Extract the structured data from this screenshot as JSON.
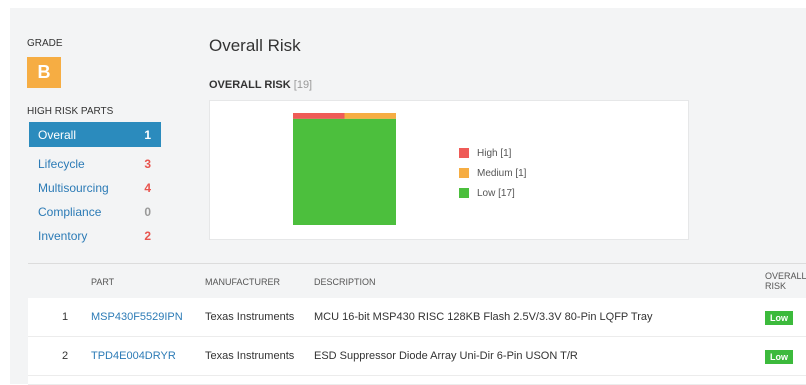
{
  "grade": {
    "label": "GRADE",
    "value": "B",
    "color": "#f6ad43"
  },
  "high_risk_parts": {
    "label": "HIGH RISK PARTS",
    "items": [
      {
        "label": "Overall",
        "count": "1",
        "active": true
      },
      {
        "label": "Lifecycle",
        "count": "3"
      },
      {
        "label": "Multisourcing",
        "count": "4"
      },
      {
        "label": "Compliance",
        "count": "0"
      },
      {
        "label": "Inventory",
        "count": "2"
      }
    ]
  },
  "page_title": "Overall Risk",
  "chart": {
    "title": "OVERALL RISK",
    "total": "[19]",
    "legend": [
      {
        "label": "High [1]",
        "color": "#ef5b57"
      },
      {
        "label": "Medium [1]",
        "color": "#f6ad43"
      },
      {
        "label": "Low [17]",
        "color": "#4cbf3d"
      }
    ]
  },
  "chart_data": {
    "type": "bar",
    "categories": [
      "High",
      "Medium",
      "Low"
    ],
    "values": [
      1,
      1,
      17
    ]
  },
  "table": {
    "columns": [
      "PART",
      "MANUFACTURER",
      "DESCRIPTION",
      "OVERALL",
      "RISK"
    ],
    "rows": [
      {
        "num": "1",
        "part": "MSP430F5529IPN",
        "manufacturer": "Texas Instruments",
        "description": "MCU 16-bit MSP430 RISC 128KB Flash 2.5V/3.3V 80-Pin LQFP Tray",
        "risk": "Low"
      },
      {
        "num": "2",
        "part": "TPD4E004DRYR",
        "manufacturer": "Texas Instruments",
        "description": "ESD Suppressor Diode Array Uni-Dir 6-Pin USON T/R",
        "risk": "Low"
      }
    ]
  }
}
